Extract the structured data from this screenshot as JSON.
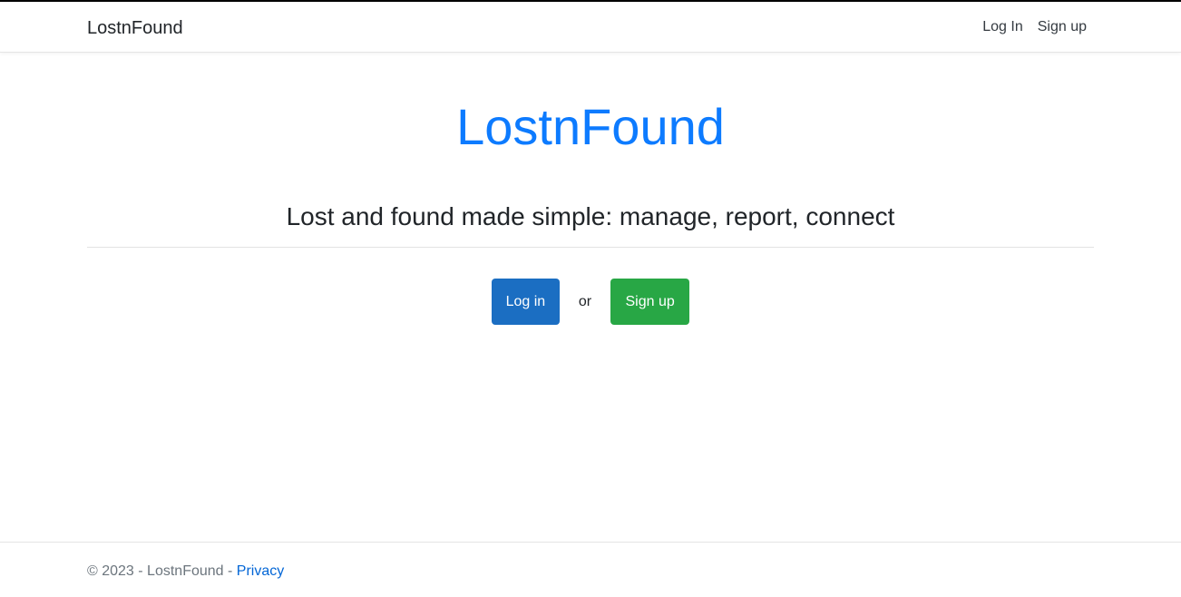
{
  "navbar": {
    "brand": "LostnFound",
    "links": [
      {
        "label": "Log In"
      },
      {
        "label": "Sign up"
      }
    ]
  },
  "hero": {
    "title": "LostnFound",
    "subtitle": "Lost and found made simple: manage, report, connect"
  },
  "actions": {
    "login_label": "Log in",
    "separator": "or",
    "signup_label": "Sign up"
  },
  "footer": {
    "copyright": "© 2023 - LostnFound - ",
    "privacy_label": "Privacy"
  },
  "colors": {
    "title": "#0d7bff",
    "login_button": "#1b6ec2",
    "signup_button": "#28a745",
    "link": "#0366d6"
  }
}
